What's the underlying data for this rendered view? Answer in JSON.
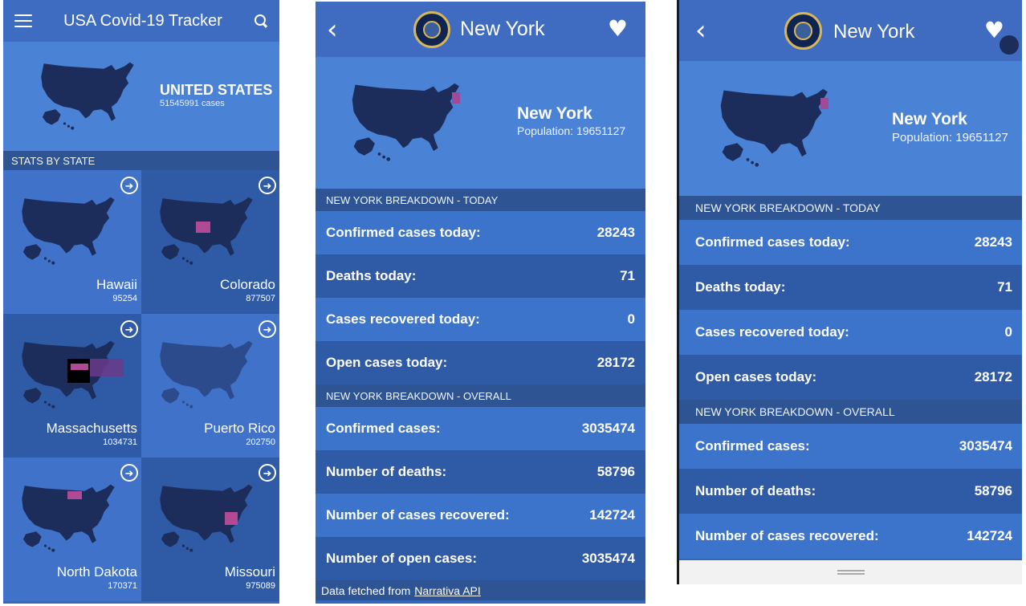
{
  "app": {
    "title": "USA Covid-19 Tracker"
  },
  "overview": {
    "country_name": "UNITED STATES",
    "country_cases": "51545991 cases",
    "section_title": "STATS BY STATE",
    "states": [
      {
        "name": "Hawaii",
        "value": "95254"
      },
      {
        "name": "Colorado",
        "value": "877507"
      },
      {
        "name": "Massachusetts",
        "value": "1034731"
      },
      {
        "name": "Puerto Rico",
        "value": "202750"
      },
      {
        "name": "North Dakota",
        "value": "170371"
      },
      {
        "name": "Missouri",
        "value": "975089"
      }
    ]
  },
  "detail": {
    "title": "New York",
    "state_name": "New York",
    "population": "Population: 19651127",
    "today_header": "NEW YORK BREAKDOWN - TODAY",
    "today": [
      {
        "label": "Confirmed cases today:",
        "value": "28243"
      },
      {
        "label": "Deaths today:",
        "value": "71"
      },
      {
        "label": "Cases recovered today:",
        "value": "0"
      },
      {
        "label": "Open cases today:",
        "value": "28172"
      }
    ],
    "overall_header": "NEW YORK BREAKDOWN - OVERALL",
    "overall": [
      {
        "label": "Confirmed cases:",
        "value": "3035474"
      },
      {
        "label": "Number of deaths:",
        "value": "58796"
      },
      {
        "label": "Number of cases recovered:",
        "value": "142724"
      },
      {
        "label": "Number of open cases:",
        "value": "3035474"
      }
    ],
    "footer_text": "Data fetched from",
    "footer_link": "Narrativa API"
  },
  "icons": {
    "menu": "hamburger-icon",
    "search": "search-icon",
    "back": "chevron-left-icon",
    "favorite": "heart-icon",
    "open_state": "arrow-circle-right-icon",
    "seal": "new-york-seal-icon"
  },
  "colors": {
    "primary": "#3f6cc0",
    "header_dark": "#2e5494",
    "hero": "#4a82d6",
    "map_fill": "#1c2d5c",
    "highlight": "#a04b9a"
  }
}
